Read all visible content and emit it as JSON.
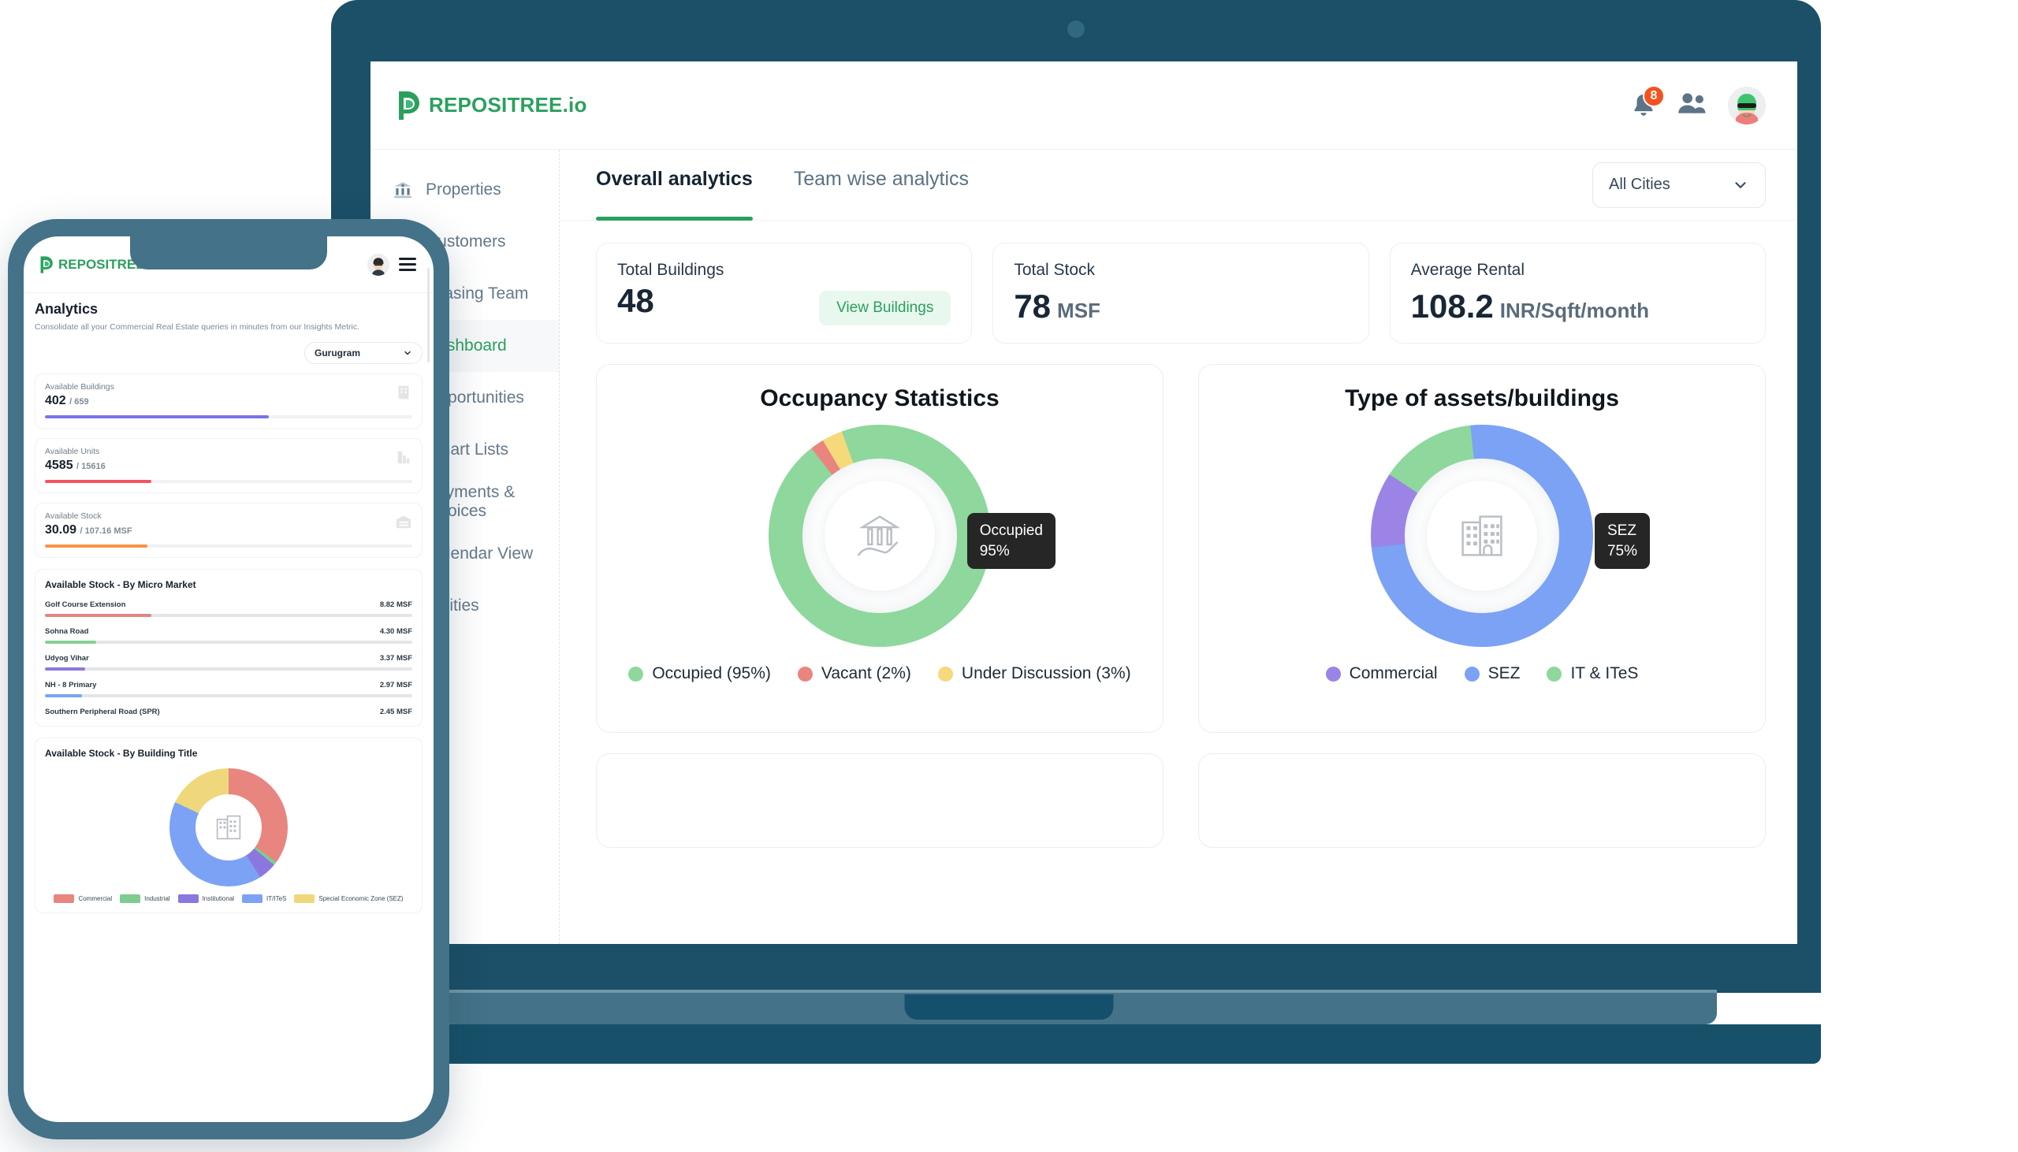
{
  "desktop": {
    "brand": {
      "name": "REPOSITREE.io"
    },
    "header": {
      "notifications_count": "8",
      "bell_icon": "bell-icon",
      "team_icon": "users-icon",
      "avatar_icon": "user-avatar"
    },
    "sidebar": {
      "items": [
        {
          "label": "Properties",
          "icon": "bank-icon",
          "active": false
        },
        {
          "label": "Customers",
          "icon": "person-icon",
          "active": false
        },
        {
          "label": "Leasing Team",
          "icon": "team-icon",
          "active": false
        },
        {
          "label": "Dashboard",
          "icon": "dashboard-icon",
          "active": true
        },
        {
          "label": "Opportunities",
          "icon": "opportunity-icon",
          "active": false
        },
        {
          "label": "Smart Lists",
          "icon": "list-icon",
          "active": false
        },
        {
          "label": "Payments & Invoices",
          "icon": "invoice-icon",
          "active": false
        },
        {
          "label": "Calendar View",
          "icon": "calendar-icon",
          "active": false
        },
        {
          "label": "Utilities",
          "icon": "utilities-icon",
          "active": false
        }
      ]
    },
    "tabs": [
      {
        "label": "Overall analytics",
        "active": true
      },
      {
        "label": "Team wise analytics",
        "active": false
      }
    ],
    "city_filter": {
      "value": "All Cities",
      "chevron": "chevron-down-icon"
    },
    "stats": [
      {
        "label": "Total Buildings",
        "value": "48",
        "unit": "",
        "action": "View Buildings"
      },
      {
        "label": "Total Stock",
        "value": "78",
        "unit": "MSF",
        "action": ""
      },
      {
        "label": "Average Rental",
        "value": "108.2",
        "unit": "INR/Sqft/month",
        "action": ""
      }
    ],
    "charts": [
      {
        "title": "Occupancy Statistics",
        "center_icon": "property-in-hand-icon",
        "tooltip": {
          "label": "Occupied",
          "value": "95%"
        },
        "legend": [
          {
            "label": "Occupied  (95%)",
            "color": "#8ed79d"
          },
          {
            "label": "Vacant (2%)",
            "color": "#e9857e"
          },
          {
            "label": "Under Discussion (3%)",
            "color": "#f5d97b"
          }
        ]
      },
      {
        "title": "Type of assets/buildings",
        "center_icon": "building-icon",
        "tooltip": {
          "label": "SEZ",
          "value": "75%"
        },
        "legend": [
          {
            "label": "Commercial",
            "color": "#9b84e6"
          },
          {
            "label": "SEZ",
            "color": "#7ba2f4"
          },
          {
            "label": "IT & ITeS",
            "color": "#8ed79d"
          }
        ]
      }
    ],
    "chart_data": [
      {
        "type": "pie",
        "title": "Occupancy Statistics",
        "categories": [
          "Occupied",
          "Vacant",
          "Under Discussion"
        ],
        "values": [
          95,
          2,
          3
        ],
        "colors": [
          "#8ed79d",
          "#e9857e",
          "#f5d97b"
        ],
        "unit": "%",
        "legend_position": "bottom",
        "annotations": [
          "Occupied 95%"
        ]
      },
      {
        "type": "pie",
        "title": "Type of assets/buildings",
        "categories": [
          "SEZ",
          "Commercial",
          "IT & ITeS"
        ],
        "values": [
          75,
          11,
          14
        ],
        "colors": [
          "#7ba2f4",
          "#9b84e6",
          "#8ed79d"
        ],
        "unit": "%",
        "legend_position": "bottom",
        "annotations": [
          "SEZ 75%"
        ]
      }
    ]
  },
  "phone": {
    "brand": {
      "name": "REPOSITREE.io"
    },
    "menu_icon": "hamburger-icon",
    "avatar_icon": "user-avatar",
    "title": "Analytics",
    "subtitle": "Consolidate all your Commercial Real Estate queries in minutes from our Insights Metric.",
    "city_filter": {
      "value": "Gurugram",
      "chevron": "chevron-down-icon"
    },
    "stats": [
      {
        "label": "Available Buildings",
        "value": "402",
        "total": "/ 659",
        "percent": 61,
        "color": "#7a74e8",
        "icon": "building-icon"
      },
      {
        "label": "Available Units",
        "value": "4585",
        "total": "/ 15616",
        "percent": 29,
        "color": "#f4535f",
        "icon": "units-icon"
      },
      {
        "label": "Available Stock",
        "value": "30.09",
        "total": "/ 107.16 MSF",
        "percent": 28,
        "color": "#f79249",
        "icon": "warehouse-icon"
      }
    ],
    "micro_market": {
      "title": "Available Stock - By Micro Market",
      "rows": [
        {
          "label": "Golf Course Extension",
          "value": "8.82 MSF",
          "percent": 29,
          "color": "#e08680"
        },
        {
          "label": "Sohna Road",
          "value": "4.30 MSF",
          "percent": 14,
          "color": "#86cf96"
        },
        {
          "label": "Udyog Vihar",
          "value": "3.37 MSF",
          "percent": 11,
          "color": "#8a78e0"
        },
        {
          "label": "NH - 8 Primary",
          "value": "2.97 MSF",
          "percent": 10,
          "color": "#7ba2f4"
        },
        {
          "label": "Southern Peripheral Road (SPR)",
          "value": "2.45 MSF",
          "percent": 8,
          "color": "#f5d97b"
        }
      ]
    },
    "building_title": {
      "title": "Available Stock - By Building Title",
      "center_icon": "building-icon",
      "legend": [
        {
          "label": "Commercial",
          "color": "#e8857f"
        },
        {
          "label": "Industrial",
          "color": "#7fcb91"
        },
        {
          "label": "Institutional",
          "color": "#8a78e0"
        },
        {
          "label": "IT/ITeS",
          "color": "#7ba2f4"
        },
        {
          "label": "Special Economic Zone (SEZ)",
          "color": "#efd87c"
        }
      ]
    },
    "chart_data": {
      "type": "pie",
      "title": "Available Stock - By Building Title",
      "categories": [
        "Commercial",
        "Industrial",
        "Institutional",
        "IT/ITeS",
        "Special Economic Zone (SEZ)"
      ],
      "values": [
        35,
        1,
        5,
        41,
        18
      ],
      "colors": [
        "#e8857f",
        "#7fcb91",
        "#8a78e0",
        "#7ba2f4",
        "#efd87c"
      ],
      "unit": "%",
      "legend_position": "bottom"
    }
  }
}
